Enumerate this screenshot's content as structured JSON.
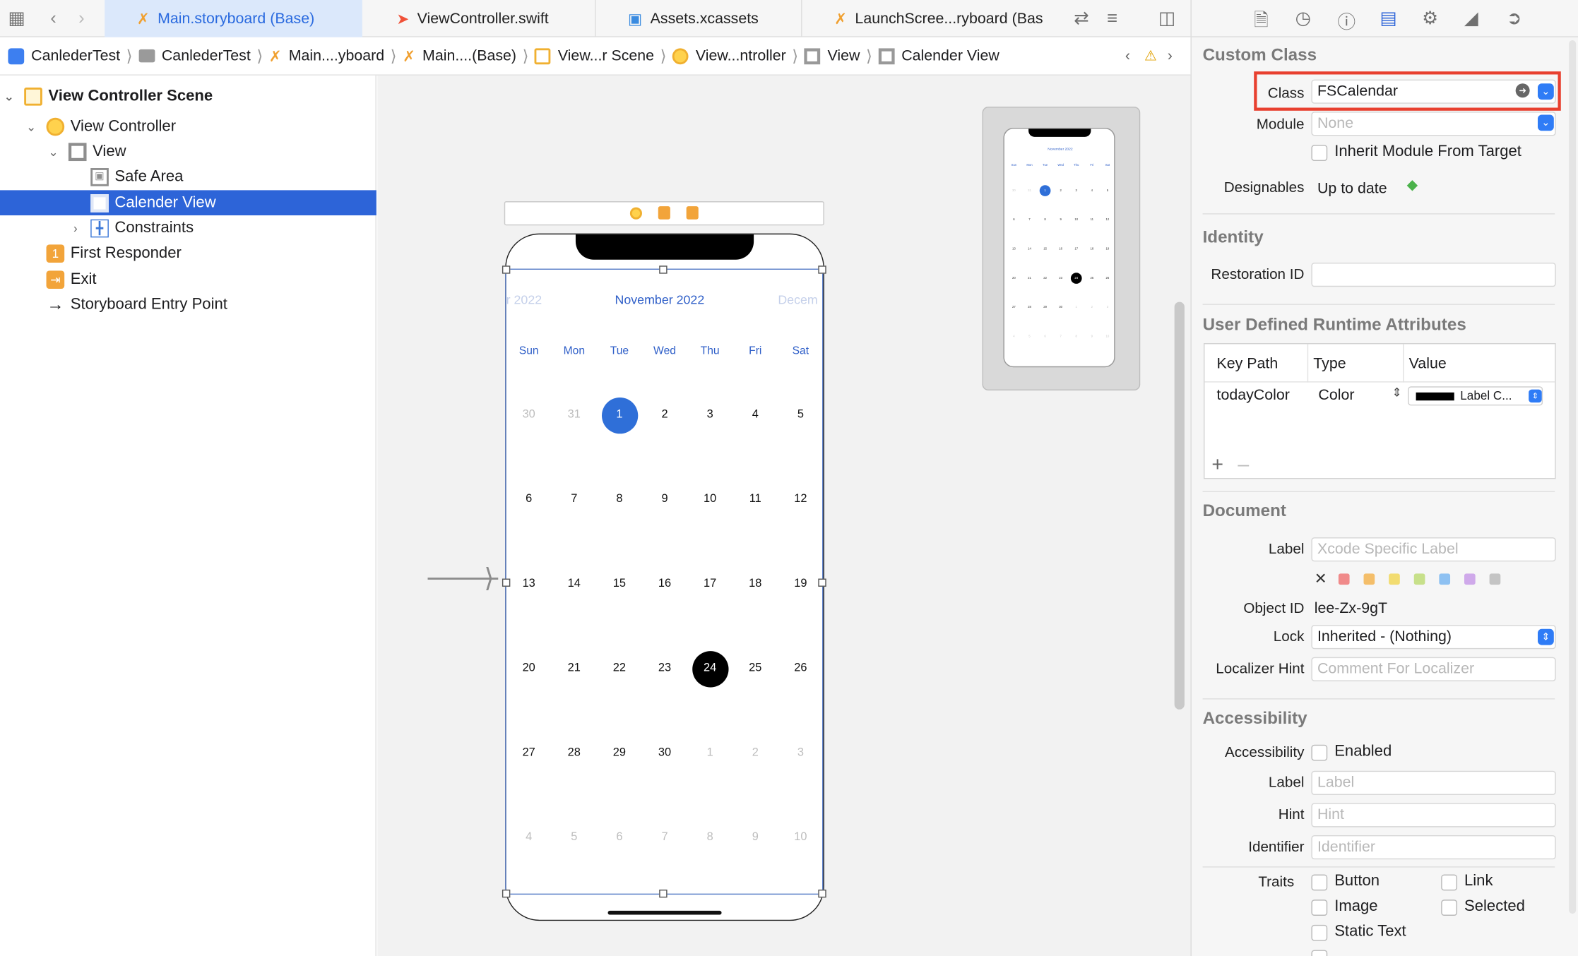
{
  "tabs": [
    {
      "label": "Main.storyboard (Base)",
      "icon": "storyboard-icon",
      "active": true
    },
    {
      "label": "ViewController.swift",
      "icon": "swift-icon",
      "active": false
    },
    {
      "label": "Assets.xcassets",
      "icon": "assets-icon",
      "active": false
    },
    {
      "label": "LaunchScree...ryboard (Bas",
      "icon": "storyboard-icon",
      "active": false
    }
  ],
  "breadcrumbs": [
    "CanlederTest",
    "CanlederTest",
    "Main....yboard",
    "Main....(Base)",
    "View...r Scene",
    "View...ntroller",
    "View",
    "Calender View"
  ],
  "navigator": {
    "scene": "View Controller Scene",
    "items": [
      {
        "label": "View Controller"
      },
      {
        "label": "View"
      },
      {
        "label": "Safe Area"
      },
      {
        "label": "Calender View"
      },
      {
        "label": "Constraints"
      },
      {
        "label": "First Responder"
      },
      {
        "label": "Exit"
      },
      {
        "label": "Storyboard Entry Point"
      }
    ]
  },
  "calendar": {
    "prev_month": "r 2022",
    "month": "November 2022",
    "next_month": "Decem",
    "weekdays": [
      "Sun",
      "Mon",
      "Tue",
      "Wed",
      "Thu",
      "Fri",
      "Sat"
    ],
    "weeks": [
      [
        "30",
        "31",
        "1",
        "2",
        "3",
        "4",
        "5"
      ],
      [
        "6",
        "7",
        "8",
        "9",
        "10",
        "11",
        "12"
      ],
      [
        "13",
        "14",
        "15",
        "16",
        "17",
        "18",
        "19"
      ],
      [
        "20",
        "21",
        "22",
        "23",
        "24",
        "25",
        "26"
      ],
      [
        "27",
        "28",
        "29",
        "30",
        "1",
        "2",
        "3"
      ],
      [
        "4",
        "5",
        "6",
        "7",
        "8",
        "9",
        "10"
      ]
    ],
    "selected_day": "1",
    "today_day": "24",
    "selection_color": "#2f6fd8",
    "today_color": "#000000"
  },
  "inspector": {
    "custom_class": {
      "title": "Custom Class",
      "class_label": "Class",
      "class_value": "FSCalendar",
      "module_label": "Module",
      "module_placeholder": "None",
      "inherit_label": "Inherit Module From Target",
      "designables_label": "Designables",
      "designables_value": "Up to date"
    },
    "identity": {
      "title": "Identity",
      "restoration_label": "Restoration ID"
    },
    "runtime_attrs": {
      "title": "User Defined Runtime Attributes",
      "headers": [
        "Key Path",
        "Type",
        "Value"
      ],
      "row": {
        "key": "todayColor",
        "type": "Color",
        "value": "Label C..."
      }
    },
    "document": {
      "title": "Document",
      "label_label": "Label",
      "label_placeholder": "Xcode Specific Label",
      "object_id_label": "Object ID",
      "object_id_value": "lee-Zx-9gT",
      "lock_label": "Lock",
      "lock_value": "Inherited - (Nothing)",
      "localizer_label": "Localizer Hint",
      "localizer_placeholder": "Comment For Localizer",
      "swatches": [
        "#f08a8a",
        "#f4be6a",
        "#f2dc70",
        "#c7e08a",
        "#8ec1f2",
        "#cfa9ea",
        "#c4c4c4"
      ]
    },
    "accessibility": {
      "title": "Accessibility",
      "acc_label": "Accessibility",
      "enabled_label": "Enabled",
      "label_label": "Label",
      "label_placeholder": "Label",
      "hint_label": "Hint",
      "hint_placeholder": "Hint",
      "identifier_label": "Identifier",
      "identifier_placeholder": "Identifier",
      "traits_label": "Traits",
      "traits": [
        "Button",
        "Link",
        "Image",
        "Selected",
        "Static Text"
      ]
    }
  },
  "highlight_color": "#e8402f",
  "accent_color": "#2d64d8"
}
